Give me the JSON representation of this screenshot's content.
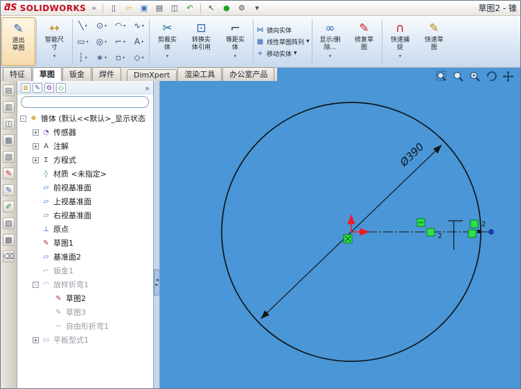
{
  "ui": {
    "caret": "▾"
  },
  "titlebar": {
    "logo_mark": "ƌS",
    "logo_text": "SOLIDWORKS",
    "chevron": "»",
    "doc_title": "草图2 - 锥",
    "buttons": [
      {
        "name": "new-document-icon",
        "glyph": "▯"
      },
      {
        "name": "open-folder-icon",
        "glyph": "▱"
      },
      {
        "name": "save-icon",
        "glyph": "▣"
      },
      {
        "name": "print-icon",
        "glyph": "▤"
      },
      {
        "name": "print-preview-icon",
        "glyph": "◫"
      },
      {
        "name": "undo-icon",
        "glyph": "↶"
      },
      {
        "name": "select-arrow-icon",
        "glyph": "↖"
      },
      {
        "name": "rebuild-icon",
        "glyph": "●"
      },
      {
        "name": "options-icon",
        "glyph": "⚙"
      },
      {
        "name": "toolbar-dropdown-icon",
        "glyph": "▾"
      }
    ]
  },
  "ribbon": {
    "exit_sketch": {
      "glyph": "✎",
      "line1": "退出",
      "line2": "草图"
    },
    "smart_dimension": {
      "glyph": "↔",
      "line1": "智能尺",
      "line2": "寸"
    },
    "grid": [
      {
        "name": "line-tool-icon",
        "glyph": "╲"
      },
      {
        "name": "circle-tool-icon",
        "glyph": "⊙"
      },
      {
        "name": "arc-tool-icon",
        "glyph": "◠"
      },
      {
        "name": "spline-tool-icon",
        "glyph": "∿"
      },
      {
        "name": "rectangle-tool-icon",
        "glyph": "▭"
      },
      {
        "name": "ellipse-tool-icon",
        "glyph": "◎"
      },
      {
        "name": "sketch-fillet-tool-icon",
        "glyph": "⌐"
      },
      {
        "name": "text-tool-icon",
        "glyph": "A"
      },
      {
        "name": "centerline-tool-icon",
        "glyph": "┆"
      },
      {
        "name": "point-tool-icon",
        "glyph": "∗"
      },
      {
        "name": "construction-geometry-icon",
        "glyph": "▫"
      },
      {
        "name": "snap-tool-icon",
        "glyph": "◇"
      }
    ],
    "trim": {
      "glyph": "✂",
      "line1": "剪裁实",
      "line2": "体"
    },
    "convert": {
      "glyph": "⊡",
      "line1": "转换实",
      "line2": "体引用"
    },
    "offset": {
      "glyph": "⌐",
      "line1": "等距实",
      "line2": "体"
    },
    "rows": [
      {
        "label": "镜向实体"
      },
      {
        "label": "线性草图阵列"
      },
      {
        "label": "移动实体"
      }
    ],
    "display_delete": {
      "glyph": "∞",
      "line1": "显示/删",
      "line2": "除..."
    },
    "repair": {
      "glyph": "✎",
      "line1": "修复草",
      "line2": "图"
    },
    "quick_snaps": {
      "glyph": "∩",
      "line1": "快速捕",
      "line2": "捉"
    },
    "rapid_sketch": {
      "glyph": "✎",
      "line1": "快速草",
      "line2": "图"
    }
  },
  "tabs": {
    "items": [
      {
        "label": "特征"
      },
      {
        "label": "草图"
      },
      {
        "label": "钣金"
      },
      {
        "label": "焊件"
      },
      {
        "label": "DimXpert"
      },
      {
        "label": "渲染工具"
      },
      {
        "label": "办公室产品"
      }
    ]
  },
  "left_toolbar": {
    "items": [
      {
        "name": "feature-palette-icon",
        "glyph": "▤"
      },
      {
        "name": "sketch-palette-icon",
        "glyph": "▥"
      },
      {
        "name": "plane-palette-icon",
        "glyph": "◫"
      },
      {
        "name": "cube-palette-icon",
        "glyph": "▦"
      },
      {
        "name": "note-palette-icon",
        "glyph": "▧"
      },
      {
        "name": "pencil-red-icon",
        "glyph": "✎"
      },
      {
        "name": "pencil-blue-icon",
        "glyph": "✎"
      },
      {
        "name": "marker-green-icon",
        "glyph": "✐"
      },
      {
        "name": "clipboard-icon",
        "glyph": "▨"
      },
      {
        "name": "book-icon",
        "glyph": "▩"
      },
      {
        "name": "eraser-icon",
        "glyph": "⌫"
      }
    ]
  },
  "tree": {
    "header_chevron": "»",
    "filter_value": "",
    "items": [
      {
        "label": "锥体 (默认<<默认>_显示状态",
        "glyph": "❖",
        "expand": "-"
      },
      {
        "label": "传感器",
        "glyph": "◔",
        "expand": "+"
      },
      {
        "label": "注解",
        "glyph": "A",
        "expand": "+"
      },
      {
        "label": "方程式",
        "glyph": "Σ",
        "expand": "+"
      },
      {
        "label": "材质 <未指定>",
        "glyph": "◊"
      },
      {
        "label": "前视基准面",
        "glyph": "▱"
      },
      {
        "label": "上视基准面",
        "glyph": "▱"
      },
      {
        "label": "右视基准面",
        "glyph": "▱"
      },
      {
        "label": "原点",
        "glyph": "⊥"
      },
      {
        "label": "草图1",
        "glyph": "✎"
      },
      {
        "label": "基准面2",
        "glyph": "▱"
      },
      {
        "label": "钣金1",
        "glyph": "⌐"
      },
      {
        "label": "放样折弯1",
        "glyph": "◠",
        "expand": "-"
      },
      {
        "label": "草图2",
        "glyph": "✎"
      },
      {
        "label": "草图3",
        "glyph": "✎"
      },
      {
        "label": "自由形折弯1",
        "glyph": "~"
      },
      {
        "label": "平板型式1",
        "glyph": "▭",
        "expand": "+"
      }
    ]
  },
  "viewport": {
    "dimension_label": "Ø390",
    "relation_label_1": "2",
    "relation_label_2": "2"
  },
  "colors": {
    "viewport_blue": "#4a96d6",
    "relation_green": "#2ee04a",
    "origin_red": "#ee1c25",
    "sketch_black": "#10151a"
  }
}
